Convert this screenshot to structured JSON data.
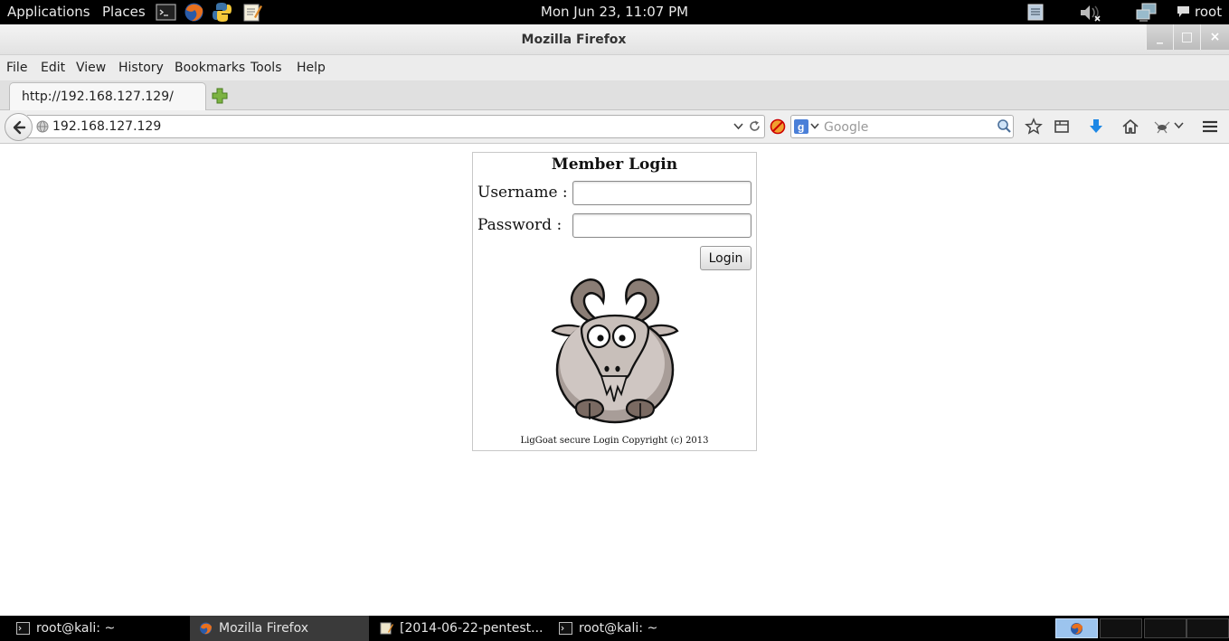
{
  "panel": {
    "applications_label": "Applications",
    "places_label": "Places",
    "clock": "Mon Jun 23, 11:07 PM",
    "user": "root"
  },
  "window": {
    "title": "Mozilla Firefox",
    "minimize": "_",
    "maximize": "□",
    "close": "×"
  },
  "menubar": {
    "items": [
      "File",
      "Edit",
      "View",
      "History",
      "Bookmarks",
      "Tools",
      "Help"
    ]
  },
  "tabs": [
    {
      "label": "http://192.168.127.129/"
    }
  ],
  "navbar": {
    "url": "192.168.127.129",
    "search_placeholder": "Google"
  },
  "page": {
    "title": "Member Login",
    "username_label": "Username  :",
    "password_label": "Password   :",
    "username_value": "",
    "password_value": "",
    "login_button": "Login",
    "copyright": "LigGoat secure Login Copyright (c) 2013"
  },
  "taskbar": {
    "items": [
      {
        "label": "root@kali: ~",
        "icon": "terminal-icon"
      },
      {
        "label": "Mozilla Firefox",
        "icon": "firefox-icon"
      },
      {
        "label": "[2014-06-22-pentest...",
        "icon": "text-editor-icon"
      },
      {
        "label": "root@kali: ~",
        "icon": "terminal-icon"
      }
    ]
  },
  "colors": {
    "panel_bg": "#000000",
    "chrome_bg": "#ececec",
    "workspace_active": "#9cc4ee"
  }
}
